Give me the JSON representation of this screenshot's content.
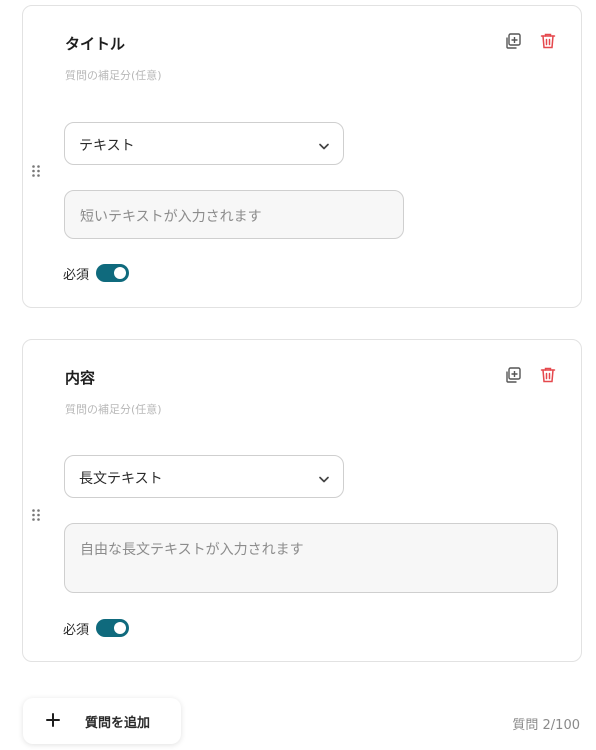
{
  "questions": [
    {
      "title": "タイトル",
      "description_placeholder": "質問の補足分(任意)",
      "type_label": "テキスト",
      "answer_placeholder": "短いテキストが入力されます",
      "required_label": "必須",
      "required": true
    },
    {
      "title": "内容",
      "description_placeholder": "質問の補足分(任意)",
      "type_label": "長文テキスト",
      "answer_placeholder": "自由な長文テキストが入力されます",
      "required_label": "必須",
      "required": true
    }
  ],
  "footer": {
    "add_label": "質問を追加",
    "counter": "質問 2/100"
  },
  "colors": {
    "toggle_on": "#0f6a7d",
    "delete": "#e5484d"
  },
  "icons": [
    "copy-icon",
    "trash-icon",
    "drag-handle-icon",
    "chevron-down-icon",
    "plus-icon"
  ]
}
